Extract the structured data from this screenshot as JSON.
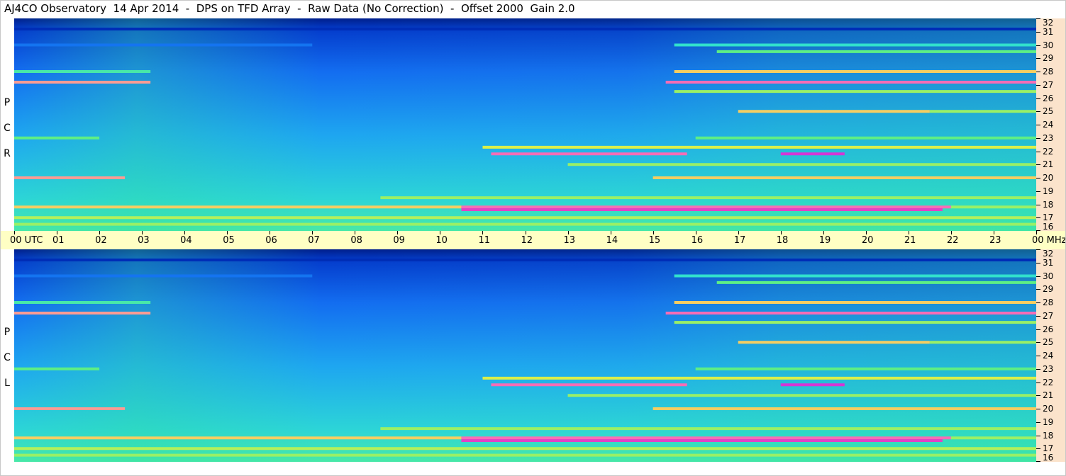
{
  "title": "AJ4CO Observatory  14 Apr 2014  -  DPS on TFD Array  -  Raw Data (No Correction)  -  Offset 2000  Gain 2.0",
  "chart_data": [
    {
      "type": "heatmap",
      "name": "RCP",
      "polarization_label": [
        "R",
        "C",
        "P"
      ],
      "x_unit": "UTC",
      "y_unit": "MHz",
      "xlim": [
        0,
        24
      ],
      "ylim": [
        16,
        32
      ],
      "colormap": [
        "#001060",
        "#0030c0",
        "#1060f0",
        "#20b0f0",
        "#30e0d0",
        "#60f080",
        "#f0f040",
        "#ff80b0",
        "#d020d0",
        "#ffffff"
      ],
      "rows": [
        {
          "freq": 31.2,
          "ranges": [
            [
              0,
              24,
              0.1
            ]
          ]
        },
        {
          "freq": 30.0,
          "ranges": [
            [
              0,
              7,
              0.25
            ],
            [
              15.5,
              24,
              0.45
            ]
          ]
        },
        {
          "freq": 29.5,
          "ranges": [
            [
              16.5,
              24,
              0.55
            ]
          ]
        },
        {
          "freq": 28.0,
          "ranges": [
            [
              0,
              3.2,
              0.5
            ],
            [
              15.5,
              24,
              0.7
            ]
          ]
        },
        {
          "freq": 27.2,
          "ranges": [
            [
              0,
              3.2,
              0.75
            ],
            [
              15.3,
              24,
              0.8
            ]
          ]
        },
        {
          "freq": 26.5,
          "ranges": [
            [
              15.5,
              24,
              0.6
            ]
          ]
        },
        {
          "freq": 25.0,
          "ranges": [
            [
              17,
              21.5,
              0.7
            ],
            [
              21.5,
              24,
              0.6
            ]
          ]
        },
        {
          "freq": 23.0,
          "ranges": [
            [
              0,
              2,
              0.55
            ],
            [
              16,
              24,
              0.55
            ]
          ]
        },
        {
          "freq": 22.3,
          "ranges": [
            [
              11,
              24,
              0.65
            ]
          ]
        },
        {
          "freq": 21.8,
          "ranges": [
            [
              11.2,
              15.8,
              0.8
            ],
            [
              18,
              19.5,
              0.9
            ]
          ]
        },
        {
          "freq": 21.0,
          "ranges": [
            [
              13,
              24,
              0.6
            ]
          ]
        },
        {
          "freq": 20.0,
          "ranges": [
            [
              0,
              2.6,
              0.75
            ],
            [
              15,
              24,
              0.7
            ]
          ]
        },
        {
          "freq": 18.5,
          "ranges": [
            [
              8.6,
              24,
              0.6
            ]
          ]
        },
        {
          "freq": 17.8,
          "ranges": [
            [
              0,
              10.5,
              0.7
            ],
            [
              10.5,
              22,
              0.8
            ],
            [
              22,
              24,
              0.6
            ]
          ]
        },
        {
          "freq": 17.6,
          "ranges": [
            [
              10.5,
              21.8,
              0.85
            ]
          ]
        },
        {
          "freq": 17.0,
          "ranges": [
            [
              0,
              24,
              0.62
            ]
          ]
        },
        {
          "freq": 16.5,
          "ranges": [
            [
              0,
              24,
              0.6
            ]
          ]
        }
      ]
    },
    {
      "type": "heatmap",
      "name": "LCP",
      "polarization_label": [
        "L",
        "C",
        "P"
      ],
      "x_unit": "UTC",
      "y_unit": "MHz",
      "xlim": [
        0,
        24
      ],
      "ylim": [
        16,
        32
      ],
      "colormap": [
        "#001060",
        "#0030c0",
        "#1060f0",
        "#20b0f0",
        "#30e0d0",
        "#60f080",
        "#f0f040",
        "#ff80b0",
        "#d020d0",
        "#ffffff"
      ],
      "rows": [
        {
          "freq": 31.2,
          "ranges": [
            [
              0,
              24,
              0.1
            ]
          ]
        },
        {
          "freq": 30.0,
          "ranges": [
            [
              0,
              7,
              0.25
            ],
            [
              15.5,
              24,
              0.45
            ]
          ]
        },
        {
          "freq": 29.5,
          "ranges": [
            [
              16.5,
              24,
              0.55
            ]
          ]
        },
        {
          "freq": 28.0,
          "ranges": [
            [
              0,
              3.2,
              0.5
            ],
            [
              15.5,
              24,
              0.7
            ]
          ]
        },
        {
          "freq": 27.2,
          "ranges": [
            [
              0,
              3.2,
              0.75
            ],
            [
              15.3,
              24,
              0.8
            ]
          ]
        },
        {
          "freq": 26.5,
          "ranges": [
            [
              15.5,
              24,
              0.6
            ]
          ]
        },
        {
          "freq": 25.0,
          "ranges": [
            [
              17,
              21.5,
              0.7
            ],
            [
              21.5,
              24,
              0.6
            ]
          ]
        },
        {
          "freq": 23.0,
          "ranges": [
            [
              0,
              2,
              0.55
            ],
            [
              16,
              24,
              0.55
            ]
          ]
        },
        {
          "freq": 22.3,
          "ranges": [
            [
              11,
              24,
              0.65
            ]
          ]
        },
        {
          "freq": 21.8,
          "ranges": [
            [
              11.2,
              15.8,
              0.8
            ],
            [
              18,
              19.5,
              0.9
            ]
          ]
        },
        {
          "freq": 21.0,
          "ranges": [
            [
              13,
              24,
              0.6
            ]
          ]
        },
        {
          "freq": 20.0,
          "ranges": [
            [
              0,
              2.6,
              0.75
            ],
            [
              15,
              24,
              0.7
            ]
          ]
        },
        {
          "freq": 18.5,
          "ranges": [
            [
              8.6,
              24,
              0.6
            ]
          ]
        },
        {
          "freq": 17.8,
          "ranges": [
            [
              0,
              10.5,
              0.7
            ],
            [
              10.5,
              22,
              0.8
            ],
            [
              22,
              24,
              0.6
            ]
          ]
        },
        {
          "freq": 17.6,
          "ranges": [
            [
              10.5,
              21.8,
              0.85
            ]
          ]
        },
        {
          "freq": 17.0,
          "ranges": [
            [
              0,
              24,
              0.62
            ]
          ]
        },
        {
          "freq": 16.5,
          "ranges": [
            [
              0,
              24,
              0.6
            ]
          ]
        }
      ]
    }
  ],
  "time_axis": {
    "labels": [
      "00  UTC",
      "01",
      "02",
      "03",
      "04",
      "05",
      "06",
      "07",
      "08",
      "09",
      "10",
      "11",
      "12",
      "13",
      "14",
      "15",
      "16",
      "17",
      "18",
      "19",
      "20",
      "21",
      "22",
      "23",
      "00 MHz"
    ]
  },
  "freq_axis": {
    "labels": [
      "32",
      "31",
      "30",
      "29",
      "28",
      "27",
      "26",
      "25",
      "24",
      "23",
      "22",
      "21",
      "20",
      "19",
      "18",
      "17",
      "16"
    ]
  }
}
